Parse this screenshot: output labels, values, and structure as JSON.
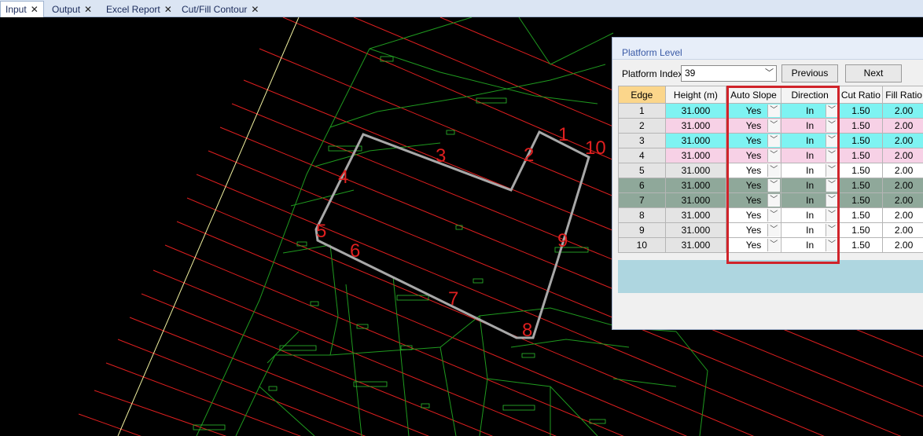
{
  "tabs": [
    {
      "label": "Input",
      "active": true
    },
    {
      "label": "Output",
      "active": false
    },
    {
      "label": "Excel Report",
      "active": false
    },
    {
      "label": "Cut/Fill Contour",
      "active": false
    }
  ],
  "canvas": {
    "edge_markers": [
      "1",
      "2",
      "3",
      "4",
      "5",
      "6",
      "7",
      "8",
      "9",
      "10"
    ]
  },
  "dialog": {
    "title": "Platform Level",
    "platform_index_label": "Platform Index",
    "platform_index_value": "39",
    "previous_label": "Previous",
    "next_label": "Next",
    "columns": [
      "Edge",
      "Height (m)",
      "Auto Slope",
      "Direction",
      "Cut Ratio",
      "Fill Ratio"
    ],
    "rows": [
      {
        "edge": "1",
        "height": "31.000",
        "auto_slope": "Yes",
        "direction": "In",
        "cut_ratio": "1.50",
        "fill_ratio": "2.00",
        "tint": "cyan"
      },
      {
        "edge": "2",
        "height": "31.000",
        "auto_slope": "Yes",
        "direction": "In",
        "cut_ratio": "1.50",
        "fill_ratio": "2.00",
        "tint": "pink"
      },
      {
        "edge": "3",
        "height": "31.000",
        "auto_slope": "Yes",
        "direction": "In",
        "cut_ratio": "1.50",
        "fill_ratio": "2.00",
        "tint": "cyan"
      },
      {
        "edge": "4",
        "height": "31.000",
        "auto_slope": "Yes",
        "direction": "In",
        "cut_ratio": "1.50",
        "fill_ratio": "2.00",
        "tint": "pink"
      },
      {
        "edge": "5",
        "height": "31.000",
        "auto_slope": "Yes",
        "direction": "In",
        "cut_ratio": "1.50",
        "fill_ratio": "2.00",
        "tint": "white"
      },
      {
        "edge": "6",
        "height": "31.000",
        "auto_slope": "Yes",
        "direction": "In",
        "cut_ratio": "1.50",
        "fill_ratio": "2.00",
        "tint": "gray"
      },
      {
        "edge": "7",
        "height": "31.000",
        "auto_slope": "Yes",
        "direction": "In",
        "cut_ratio": "1.50",
        "fill_ratio": "2.00",
        "tint": "gray"
      },
      {
        "edge": "8",
        "height": "31.000",
        "auto_slope": "Yes",
        "direction": "In",
        "cut_ratio": "1.50",
        "fill_ratio": "2.00",
        "tint": "white"
      },
      {
        "edge": "9",
        "height": "31.000",
        "auto_slope": "Yes",
        "direction": "In",
        "cut_ratio": "1.50",
        "fill_ratio": "2.00",
        "tint": "white"
      },
      {
        "edge": "10",
        "height": "31.000",
        "auto_slope": "Yes",
        "direction": "In",
        "cut_ratio": "1.50",
        "fill_ratio": "2.00",
        "tint": "white"
      }
    ],
    "colors": {
      "cyan": "#7ef3f2",
      "pink": "#f7d1e6",
      "gray": "#8fa89a",
      "highlight": "#d0232a"
    }
  },
  "icons": {
    "tab_close": "close-icon",
    "dropdown": "chevron-down-icon"
  }
}
